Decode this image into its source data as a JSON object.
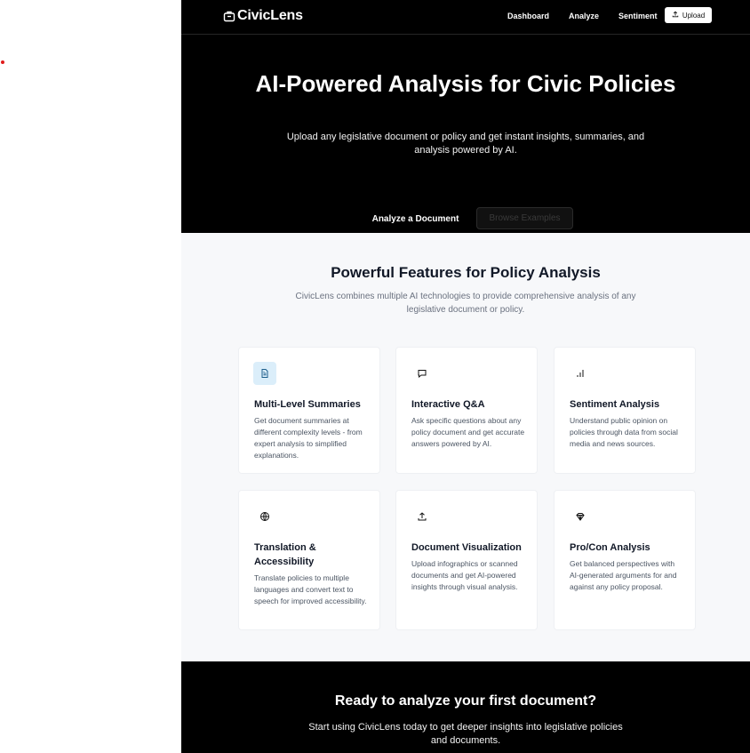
{
  "header": {
    "brand": "CivicLens",
    "nav": [
      {
        "label": "Dashboard"
      },
      {
        "label": "Analyze"
      },
      {
        "label": "Sentiment"
      }
    ],
    "upload_label": "Upload"
  },
  "hero": {
    "title": "AI-Powered Analysis for Civic Policies",
    "subtitle": "Upload any legislative document or policy and get instant insights, summaries, and analysis powered by AI.",
    "primary_label": "Analyze a Document",
    "secondary_label": "Browse Examples"
  },
  "features": {
    "title": "Powerful Features for Policy Analysis",
    "subtitle": "CivicLens combines multiple AI technologies to provide comprehensive analysis of any legislative document or policy.",
    "cards": [
      {
        "title": "Multi-Level Summaries",
        "desc": "Get document summaries at different complexity levels - from expert analysis to simplified explanations.",
        "icon": "document-icon"
      },
      {
        "title": "Interactive Q&A",
        "desc": "Ask specific questions about any policy document and get accurate answers powered by AI.",
        "icon": "chat-icon"
      },
      {
        "title": "Sentiment Analysis",
        "desc": "Understand public opinion on policies through data from social media and news sources.",
        "icon": "bar-chart-icon"
      },
      {
        "title": "Translation & Accessibility",
        "desc": "Translate policies to multiple languages and convert text to speech for improved accessibility.",
        "icon": "globe-icon"
      },
      {
        "title": "Document Visualization",
        "desc": "Upload infographics or scanned documents and get AI-powered insights through visual analysis.",
        "icon": "upload-icon"
      },
      {
        "title": "Pro/Con Analysis",
        "desc": "Get balanced perspectives with AI-generated arguments for and against any policy proposal.",
        "icon": "gem-icon"
      }
    ]
  },
  "cta": {
    "title": "Ready to analyze your first document?",
    "subtitle": "Start using CivicLens today to get deeper insights into legislative policies and documents."
  },
  "colors": {
    "dark": "#000000",
    "light_bg": "#f7f8fa",
    "icon_highlight": "#dbeefa"
  }
}
